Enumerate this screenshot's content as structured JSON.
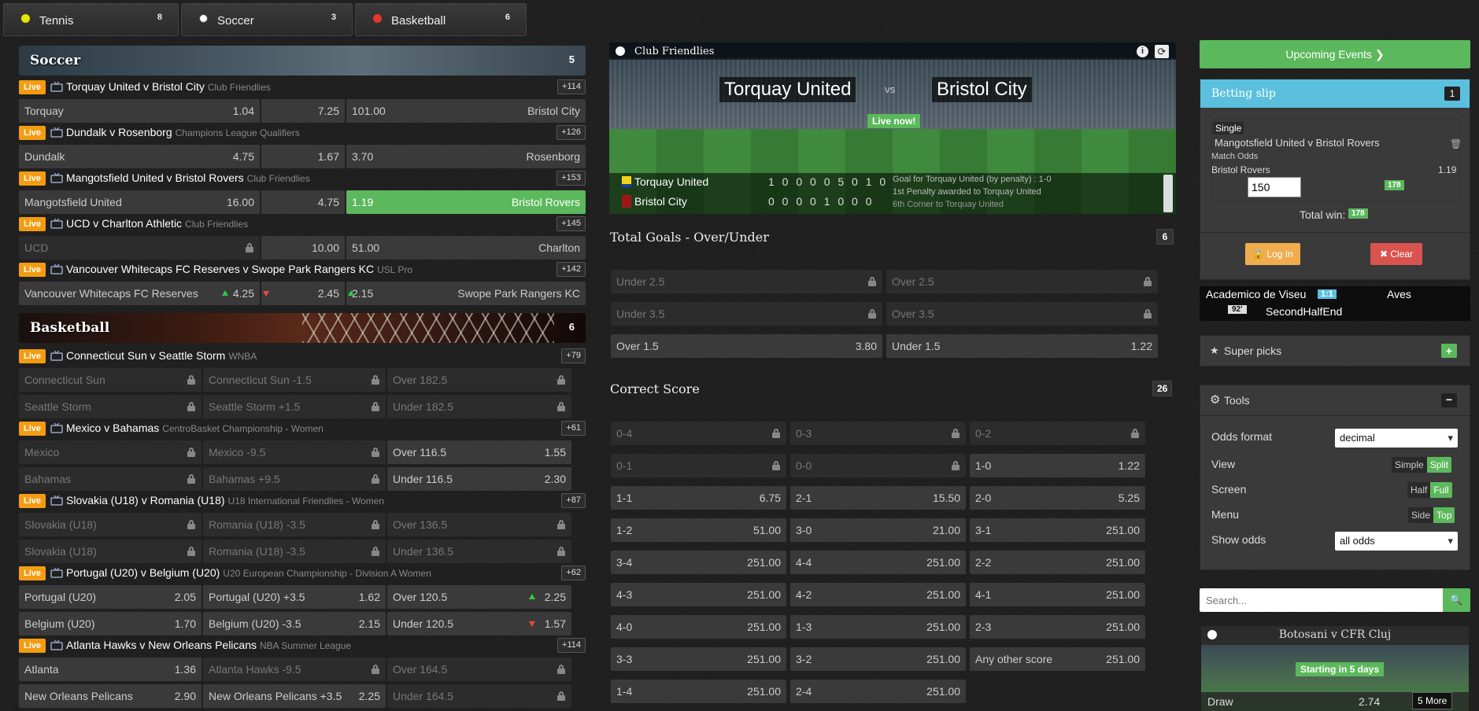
{
  "sport_tabs": [
    {
      "label": "Tennis",
      "count": "8",
      "color": "#e6e600"
    },
    {
      "label": "Soccer",
      "count": "3",
      "color": "#ffffff"
    },
    {
      "label": "Basketball",
      "count": "6",
      "color": "#e03a2a"
    }
  ],
  "soccer": {
    "title": "Soccer",
    "count": "5",
    "matches": [
      {
        "live": "Live",
        "title": "Torquay United v Bristol City",
        "league": "Club Friendlies",
        "more": "+114",
        "home": "Torquay",
        "home_odds": "1.04",
        "draw": "7.25",
        "away_odds": "101.00",
        "away": "Bristol City"
      },
      {
        "live": "Live",
        "title": "Dundalk v Rosenborg",
        "league": "Champions League Qualifiers",
        "more": "+126",
        "home": "Dundalk",
        "home_odds": "4.75",
        "draw": "1.67",
        "away_odds": "3.70",
        "away": "Rosenborg"
      },
      {
        "live": "Live",
        "title": "Mangotsfield United v Bristol Rovers",
        "league": "Club Friendlies",
        "more": "+153",
        "home": "Mangotsfield United",
        "home_odds": "16.00",
        "draw": "4.75",
        "away_odds": "1.19",
        "away": "Bristol Rovers"
      },
      {
        "live": "Live",
        "title": "UCD v Charlton Athletic",
        "league": "Club Friendlies",
        "more": "+145",
        "home": "UCD",
        "home_odds": "",
        "draw": "10.00",
        "away_odds": "51.00",
        "away": "Charlton"
      },
      {
        "live": "Live",
        "title": "Vancouver Whitecaps FC Reserves v Swope Park Rangers KC",
        "league": "USL Pro",
        "more": "+142",
        "home": "Vancouver Whitecaps FC Reserves",
        "home_odds": "4.25",
        "draw": "2.45",
        "away_odds": "2.15",
        "away": "Swope Park Rangers KC"
      }
    ]
  },
  "basketball": {
    "title": "Basketball",
    "count": "6",
    "matches": [
      {
        "live": "Live",
        "title": "Connecticut Sun v Seattle Storm",
        "league": "WNBA",
        "more": "+79",
        "rows": [
          [
            "Connecticut Sun",
            "",
            "Connecticut Sun -1.5",
            "",
            "Over 182.5",
            ""
          ],
          [
            "Seattle Storm",
            "",
            "Seattle Storm +1.5",
            "",
            "Under 182.5",
            ""
          ]
        ]
      },
      {
        "live": "Live",
        "title": "Mexico v Bahamas",
        "league": "CentroBasket Championship - Women",
        "more": "+61",
        "rows": [
          [
            "Mexico",
            "",
            "Mexico -9.5",
            "",
            "Over 116.5",
            "1.55"
          ],
          [
            "Bahamas",
            "",
            "Bahamas +9.5",
            "",
            "Under 116.5",
            "2.30"
          ]
        ]
      },
      {
        "live": "Live",
        "title": "Slovakia (U18) v Romania (U18)",
        "league": "U18 International Friendlies - Women",
        "more": "+87",
        "rows": [
          [
            "Slovakia (U18)",
            "",
            "Romania (U18) -3.5",
            "",
            "Over 136.5",
            ""
          ],
          [
            "Slovakia (U18)",
            "",
            "Romania (U18) -3.5",
            "",
            "Under 136.5",
            ""
          ]
        ]
      },
      {
        "live": "Live",
        "title": "Portugal (U20) v Belgium (U20)",
        "league": "U20 European Championship - Division A Women",
        "more": "+62",
        "rows": [
          [
            "Portugal (U20)",
            "2.05",
            "Portugal (U20) +3.5",
            "1.62",
            "Over 120.5",
            "2.25"
          ],
          [
            "Belgium (U20)",
            "1.70",
            "Belgium (U20) -3.5",
            "2.15",
            "Under 120.5",
            "1.57"
          ]
        ]
      },
      {
        "live": "Live",
        "title": "Atlanta Hawks v New Orleans Pelicans",
        "league": "NBA Summer League",
        "more": "+114",
        "rows": [
          [
            "Atlanta",
            "1.36",
            "Atlanta Hawks -9.5",
            "",
            "Over 164.5",
            ""
          ],
          [
            "New Orleans Pelicans",
            "2.90",
            "New Orleans Pelicans +3.5",
            "2.25",
            "Under 164.5",
            ""
          ]
        ]
      }
    ]
  },
  "hero": {
    "league": "Club Friendlies",
    "home": "Torquay United",
    "vs": "VS",
    "away": "Bristol City",
    "status": "Live now!",
    "score_home_team": "Torquay United",
    "score_home": "1 0 0 0 0 5 0 1 0",
    "score_away_team": "Bristol City",
    "score_away": "0 0 0 0 1 0 0 0",
    "events": [
      "Goal for Torquay United (by penalty) : 1-0",
      "1st Penalty awarded to Torquay United",
      "6th Corner to Torquay United"
    ]
  },
  "total_goals": {
    "title": "Total Goals - Over/Under",
    "count": "6",
    "rows": [
      [
        "Under 2.5",
        "",
        "Over 2.5",
        ""
      ],
      [
        "Under 3.5",
        "",
        "Over 3.5",
        ""
      ],
      [
        "Over 1.5",
        "3.80",
        "Under 1.5",
        "1.22"
      ]
    ]
  },
  "correct_score": {
    "title": "Correct Score",
    "count": "26",
    "rows": [
      [
        [
          "0-4",
          ""
        ],
        [
          "0-3",
          ""
        ],
        [
          "0-2",
          ""
        ]
      ],
      [
        [
          "0-1",
          ""
        ],
        [
          "0-0",
          ""
        ],
        [
          "1-0",
          "1.22"
        ]
      ],
      [
        [
          "1-1",
          "6.75"
        ],
        [
          "2-1",
          "15.50"
        ],
        [
          "2-0",
          "5.25"
        ]
      ],
      [
        [
          "1-2",
          "51.00"
        ],
        [
          "3-0",
          "21.00"
        ],
        [
          "3-1",
          "251.00"
        ]
      ],
      [
        [
          "3-4",
          "251.00"
        ],
        [
          "4-4",
          "251.00"
        ],
        [
          "2-2",
          "251.00"
        ]
      ],
      [
        [
          "4-3",
          "251.00"
        ],
        [
          "4-2",
          "251.00"
        ],
        [
          "4-1",
          "251.00"
        ]
      ],
      [
        [
          "4-0",
          "251.00"
        ],
        [
          "1-3",
          "251.00"
        ],
        [
          "2-3",
          "251.00"
        ]
      ],
      [
        [
          "3-3",
          "251.00"
        ],
        [
          "3-2",
          "251.00"
        ],
        [
          "Any other score",
          "251.00"
        ]
      ],
      [
        [
          "1-4",
          "251.00"
        ],
        [
          "2-4",
          "251.00"
        ]
      ]
    ]
  },
  "right": {
    "upcoming_label": "Upcoming Events",
    "slip": {
      "title": "Betting slip",
      "count": "1",
      "type": "Single",
      "match": "Mangotsfield United v Bristol Rovers",
      "market": "Match Odds",
      "selection": "Bristol Rovers",
      "odds": "1.19",
      "stake": "150",
      "stake_badge": "178",
      "total_label": "Total win:",
      "total_value": "178",
      "login_label": "Log In",
      "clear_label": "Clear"
    },
    "ticker": {
      "home": "Academico de Viseu",
      "score": "1:1",
      "away": "Aves",
      "minute": "92'",
      "status": "SecondHalfEnd"
    },
    "super_picks": "Super picks",
    "tools": {
      "title": "Tools",
      "odds_format_label": "Odds format",
      "odds_format_value": "decimal",
      "view_label": "View",
      "view_a": "Simple",
      "view_b": "Split",
      "screen_label": "Screen",
      "screen_a": "Half",
      "screen_b": "Full",
      "menu_label": "Menu",
      "menu_a": "Side",
      "menu_b": "Top",
      "show_odds_label": "Show odds",
      "show_odds_value": "all odds"
    },
    "search_placeholder": "Search...",
    "promo": {
      "title": "Botosani v CFR Cluj",
      "status": "Starting in 5 days",
      "draw_label": "Draw",
      "draw_odds": "2.74",
      "more": "5 More"
    }
  },
  "colors": {
    "live": "#f39c12",
    "selected": "#5cb85c",
    "slip_header": "#5bc0de",
    "danger": "#d9534f"
  }
}
